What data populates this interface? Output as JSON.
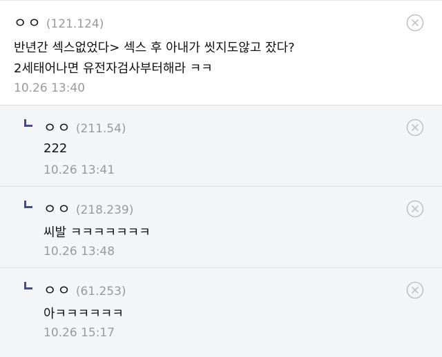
{
  "comments": [
    {
      "nickname": "ㅇㅇ",
      "ip": "(121.124)",
      "lines": [
        "반년간 섹스없었다> 섹스 후 아내가 씻지도않고 잤다?",
        "2세태어나면 유전자검사부터해라 ㅋㅋ"
      ],
      "time": "10.26 13:40"
    }
  ],
  "replies": [
    {
      "nickname": "ㅇㅇ",
      "ip": "(211.54)",
      "text": "222",
      "time": "10.26 13:41"
    },
    {
      "nickname": "ㅇㅇ",
      "ip": "(218.239)",
      "text": "씨발 ㅋㅋㅋㅋㅋㅋㅋ",
      "time": "10.26 13:48"
    },
    {
      "nickname": "ㅇㅇ",
      "ip": "(61.253)",
      "text": "아ㅋㅋㅋㅋㅋㅋ",
      "time": "10.26 15:17"
    }
  ],
  "icons": {
    "reply_marker": "reply-arrow-icon",
    "delete": "close-circle-icon"
  },
  "colors": {
    "reply_marker": "#3b4aa8",
    "reply_background": "#f4f5f7",
    "meta_text": "#9a9a9a"
  }
}
